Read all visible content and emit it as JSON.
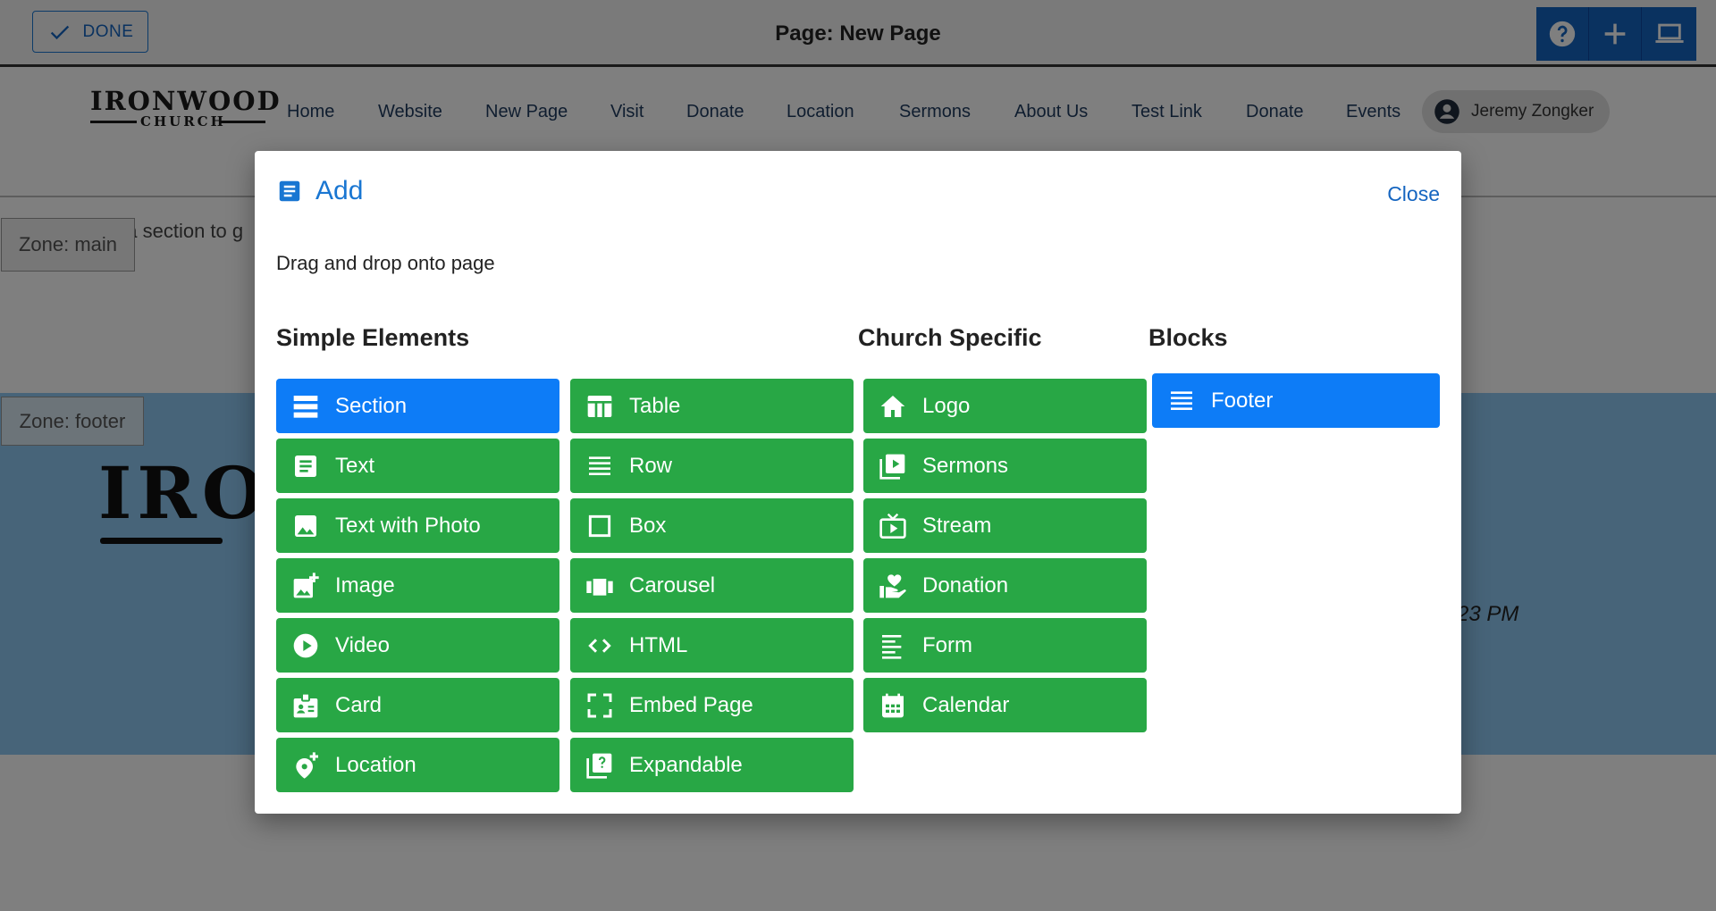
{
  "topbar": {
    "done_label": "DONE",
    "page_title": "Page: New Page",
    "tools": [
      {
        "icon": "help-icon"
      },
      {
        "icon": "plus-icon"
      },
      {
        "icon": "laptop-icon"
      }
    ]
  },
  "site": {
    "logo_top": "IRONWOOD",
    "logo_bottom": "CHURCH",
    "nav": [
      "Home",
      "Website",
      "New Page",
      "Visit",
      "Donate",
      "Location",
      "Sermons",
      "About Us",
      "Test Link",
      "Donate",
      "Events"
    ],
    "user_name": "Jeremy Zongker"
  },
  "background": {
    "zone_main": "Zone: main",
    "add_section_text": "Add a section to g",
    "zone_footer": "Zone: footer",
    "footer_logo_fragment": "IRO",
    "footer_time_fragment": "23 PM"
  },
  "modal": {
    "title": "Add",
    "close_label": "Close",
    "hint": "Drag and drop onto page",
    "headers": {
      "simple": "Simple Elements",
      "church": "Church Specific",
      "blocks": "Blocks"
    },
    "simple_col1": [
      {
        "label": "Section",
        "icon": "section-icon",
        "color": "#0d7cf7"
      },
      {
        "label": "Text",
        "icon": "text-icon",
        "color": "#28a745"
      },
      {
        "label": "Text with Photo",
        "icon": "photo-icon",
        "color": "#28a745"
      },
      {
        "label": "Image",
        "icon": "add-image-icon",
        "color": "#28a745"
      },
      {
        "label": "Video",
        "icon": "play-icon",
        "color": "#28a745"
      },
      {
        "label": "Card",
        "icon": "badge-icon",
        "color": "#28a745"
      },
      {
        "label": "Location",
        "icon": "add-location-icon",
        "color": "#28a745"
      }
    ],
    "simple_col2": [
      {
        "label": "Table",
        "icon": "table-icon",
        "color": "#28a745"
      },
      {
        "label": "Row",
        "icon": "rows-icon",
        "color": "#28a745"
      },
      {
        "label": "Box",
        "icon": "box-icon",
        "color": "#28a745"
      },
      {
        "label": "Carousel",
        "icon": "carousel-icon",
        "color": "#28a745"
      },
      {
        "label": "HTML",
        "icon": "code-icon",
        "color": "#28a745"
      },
      {
        "label": "Embed Page",
        "icon": "fullscreen-icon",
        "color": "#28a745"
      },
      {
        "label": "Expandable",
        "icon": "quiz-icon",
        "color": "#28a745"
      }
    ],
    "church": [
      {
        "label": "Logo",
        "icon": "home-icon",
        "color": "#28a745"
      },
      {
        "label": "Sermons",
        "icon": "video-library-icon",
        "color": "#28a745"
      },
      {
        "label": "Stream",
        "icon": "live-tv-icon",
        "color": "#28a745"
      },
      {
        "label": "Donation",
        "icon": "volunteer-icon",
        "color": "#28a745"
      },
      {
        "label": "Form",
        "icon": "form-icon",
        "color": "#28a745"
      },
      {
        "label": "Calendar",
        "icon": "calendar-icon",
        "color": "#28a745"
      }
    ],
    "blocks": [
      {
        "label": "Footer",
        "icon": "footer-rows-icon",
        "color": "#0d7cf7"
      }
    ]
  }
}
